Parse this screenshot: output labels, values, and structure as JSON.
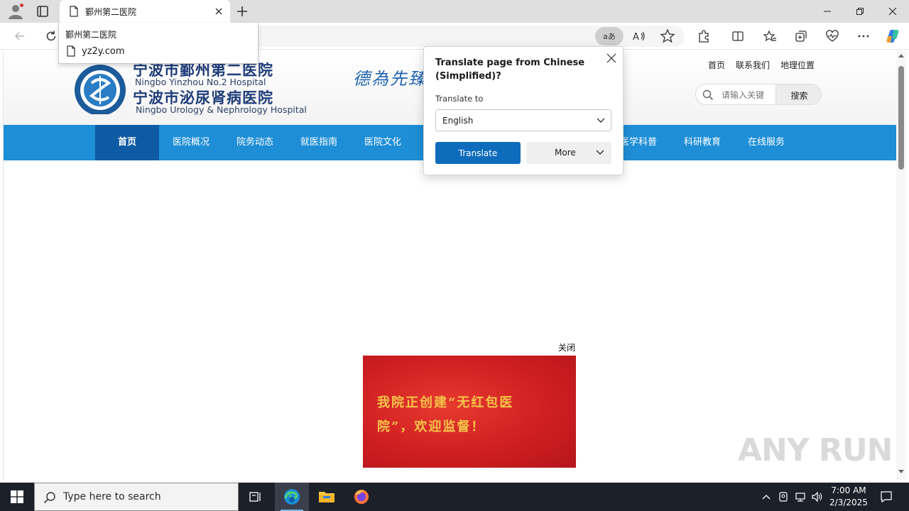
{
  "browser": {
    "tab": {
      "title": "鄞州第二医院"
    },
    "omnibox": {
      "title_suggestion": "鄞州第二医院",
      "url_suggestion": "yz2y.com"
    },
    "translate_button_label": "aあ"
  },
  "translate_popup": {
    "title": "Translate page from Chinese (Simplified)?",
    "translate_to_label": "Translate to",
    "language": "English",
    "translate_button": "Translate",
    "more_button": "More"
  },
  "page": {
    "hospital_name_1": "宁波市鄞州第二医院",
    "hospital_name_1_en": "Ningbo Yinzhou No.2 Hospital",
    "hospital_name_2": "宁波市泌尿肾病医院",
    "hospital_name_2_en": "Ningbo Urology & Nephrology Hospital",
    "motto": "德為先臻",
    "top_links": [
      "首页",
      "联系我们",
      "地理位置"
    ],
    "search": {
      "placeholder": "请输入关键",
      "button": "搜索"
    },
    "nav": [
      "首页",
      "医院概况",
      "院务动态",
      "就医指南",
      "医院文化",
      "医学科普",
      "科研教育",
      "在线服务"
    ],
    "popup_close": "关闭",
    "banner_line1": "我院正创建“无红包医",
    "banner_line2": "院”，欢迎监督！"
  },
  "watermark": "ANY RUN",
  "taskbar": {
    "search_placeholder": "Type here to search",
    "time": "7:00 AM",
    "date": "2/3/2025"
  },
  "colors": {
    "nav_bg": "#1e8ed6",
    "nav_active": "#0e5aa3",
    "translate_primary": "#0f6cbd",
    "banner_red": "#cf1f22",
    "banner_text": "#f5c54a"
  }
}
